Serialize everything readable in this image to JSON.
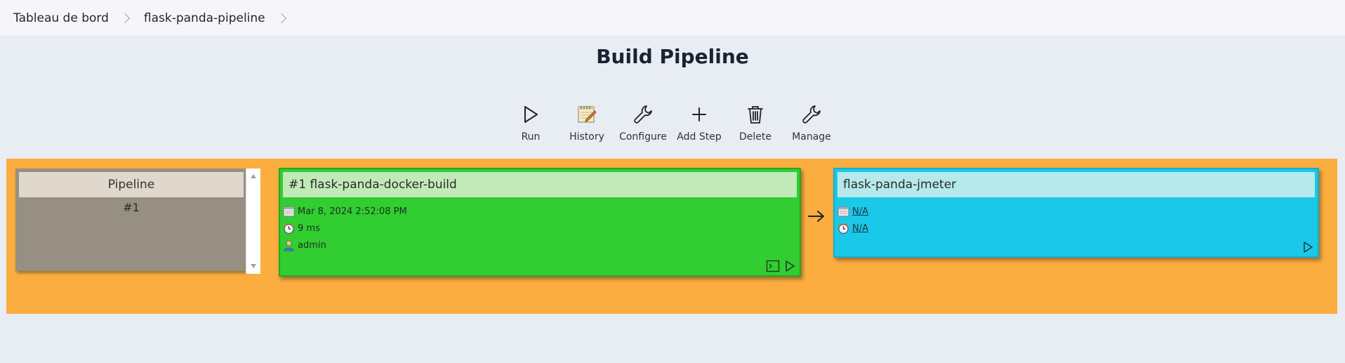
{
  "breadcrumb": {
    "items": [
      "Tableau de bord",
      "flask-panda-pipeline"
    ]
  },
  "page": {
    "title": "Build Pipeline"
  },
  "toolbar": {
    "items": [
      {
        "label": "Run",
        "icon": "play-icon"
      },
      {
        "label": "History",
        "icon": "notepad-icon"
      },
      {
        "label": "Configure",
        "icon": "wrench-icon"
      },
      {
        "label": "Add Step",
        "icon": "plus-icon"
      },
      {
        "label": "Delete",
        "icon": "trash-icon"
      },
      {
        "label": "Manage",
        "icon": "wrench-icon"
      }
    ]
  },
  "pipeline": {
    "header": "Pipeline",
    "run_number": "#1",
    "jobs": [
      {
        "title": "#1 flask-panda-docker-build",
        "date": "Mar 8, 2024 2:52:08 PM",
        "duration": "9 ms",
        "user": "admin",
        "status_color": "#31cd31"
      },
      {
        "title": "flask-panda-jmeter",
        "date": "N/A",
        "duration": "N/A",
        "status_color": "#1ac8e8"
      }
    ]
  },
  "colors": {
    "canvas": "#fbad3f",
    "pipeline_panel": "#978f82",
    "success": "#31cd31",
    "pending": "#1ac8e8"
  }
}
